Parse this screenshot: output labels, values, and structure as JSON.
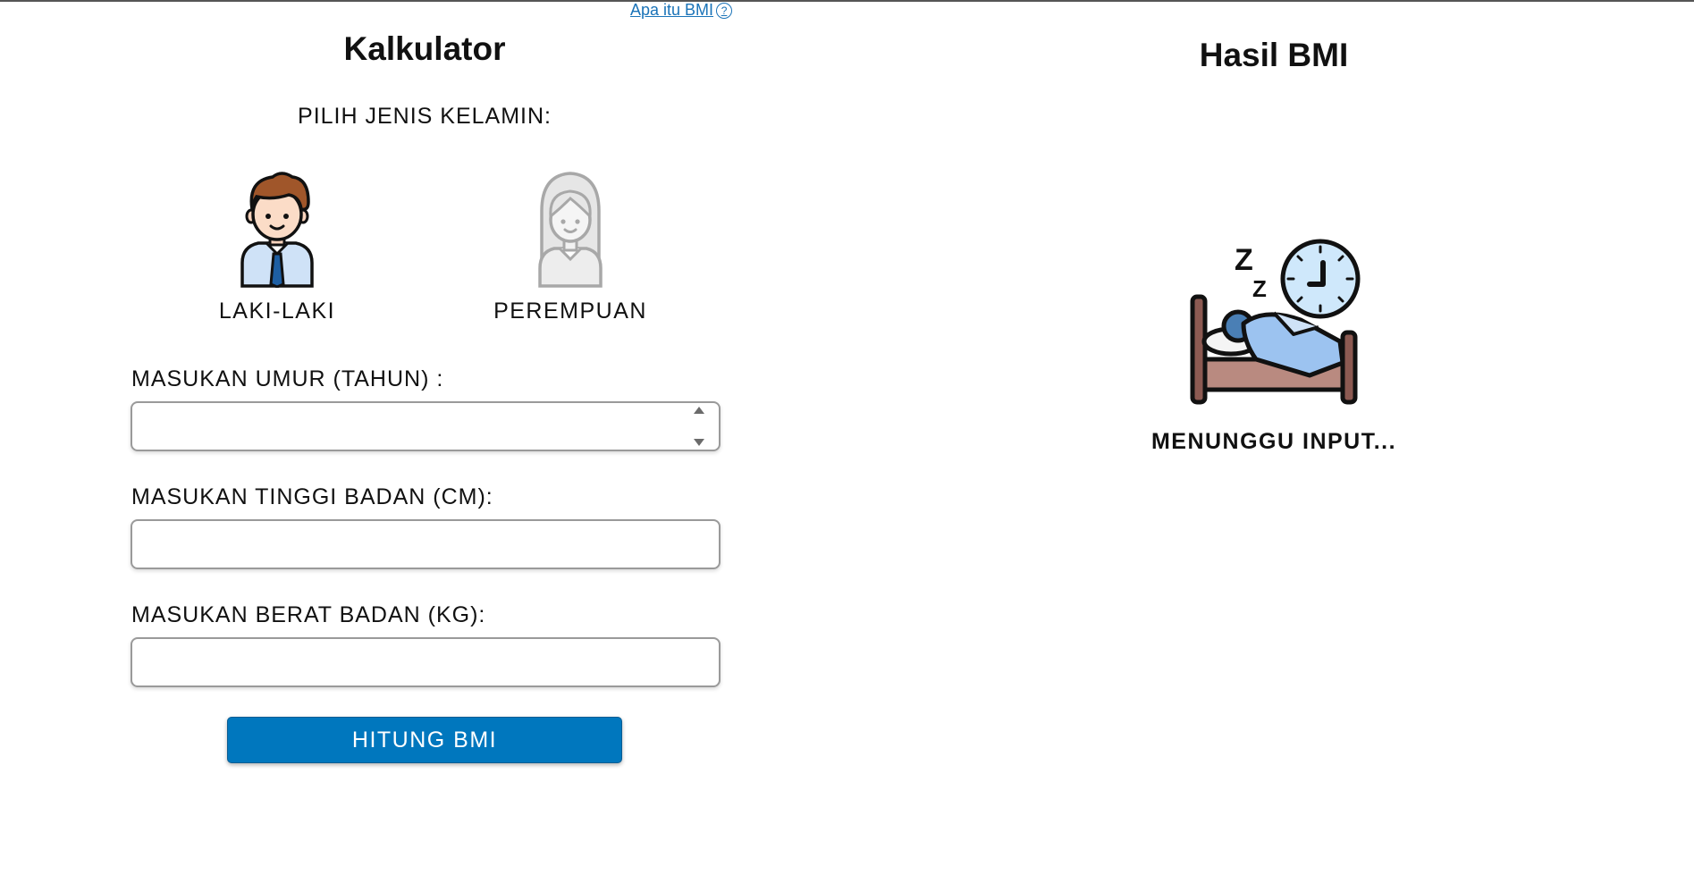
{
  "help": {
    "link_label": "Apa itu BMI",
    "icon": "question-circle-icon"
  },
  "calculator": {
    "title": "Kalkulator",
    "gender_heading": "PILIH JENIS KELAMIN:",
    "genders": [
      {
        "label": "LAKI-LAKI",
        "icon": "male-avatar-icon",
        "selected": true
      },
      {
        "label": "PEREMPUAN",
        "icon": "female-avatar-icon",
        "selected": false
      }
    ],
    "age_label": "MASUKAN UMUR (TAHUN) :",
    "age_value": "",
    "height_label": "MASUKAN TINGGI BADAN (CM):",
    "height_value": "",
    "weight_label": "MASUKAN BERAT BADAN (KG):",
    "weight_value": "",
    "submit_label": "HITUNG BMI"
  },
  "result": {
    "title": "Hasil BMI",
    "illustration": "sleeping-in-bed-icon",
    "status": "MENUNGGU INPUT..."
  },
  "colors": {
    "primary": "#0077be",
    "link": "#1a73b8",
    "hair": "#a0562a",
    "shirt": "#cfe2f7"
  }
}
